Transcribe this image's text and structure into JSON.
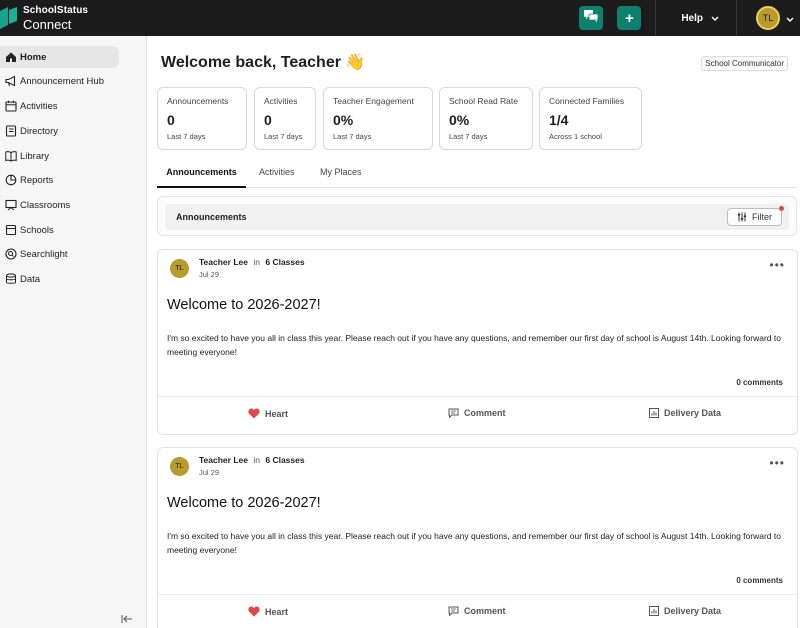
{
  "topbar": {
    "brand_line1": "SchoolStatus",
    "brand_line2": "Connect",
    "help_label": "Help",
    "user_initials": "TL",
    "accent": "#0f7f6e"
  },
  "sidebar": {
    "items": [
      {
        "label": "Home",
        "icon": "home-icon"
      },
      {
        "label": "Announcement Hub",
        "icon": "megaphone-icon"
      },
      {
        "label": "Activities",
        "icon": "activities-icon"
      },
      {
        "label": "Directory",
        "icon": "directory-icon"
      },
      {
        "label": "Library",
        "icon": "library-icon"
      },
      {
        "label": "Reports",
        "icon": "reports-pie-icon"
      },
      {
        "label": "Classrooms",
        "icon": "classrooms-icon"
      },
      {
        "label": "Schools",
        "icon": "schools-icon"
      },
      {
        "label": "Searchlight",
        "icon": "searchlight-icon"
      },
      {
        "label": "Data",
        "icon": "database-icon"
      }
    ]
  },
  "main": {
    "welcome": "Welcome back, Teacher 👋",
    "role": "School Communicator",
    "stats": [
      {
        "label": "Announcements",
        "value": "0",
        "sub": "Last 7 days"
      },
      {
        "label": "Activities",
        "value": "0",
        "sub": "Last 7 days"
      },
      {
        "label": "Teacher Engagement",
        "value": "0%",
        "sub": "Last 7 days"
      },
      {
        "label": "School Read Rate",
        "value": "0%",
        "sub": "Last 7 days"
      },
      {
        "label": "Connected Families",
        "value": "1/4",
        "sub": "Across 1 school"
      }
    ],
    "tabs": [
      "Announcements",
      "Activities",
      "My Places"
    ],
    "filter_panel_title": "Announcements",
    "filter_label": "Filter",
    "posts": [
      {
        "initials": "TL",
        "author": "Teacher Lee",
        "in": "in",
        "classes": "6 Classes",
        "date": "Jul 29",
        "title": "Welcome to 2026-2027!",
        "body": "I'm so excited to have you all in class this year. Please reach out if you have any questions, and remember our first day of school is August 14th. Looking forward to meeting everyone!",
        "comments": "0 comments",
        "heart_label": "Heart",
        "comment_label": "Comment",
        "delivery_label": "Delivery Data"
      },
      {
        "initials": "TL",
        "author": "Teacher Lee",
        "in": "in",
        "classes": "6 Classes",
        "date": "Jul 29",
        "title": "Welcome to 2026-2027!",
        "body": "I'm so excited to have you all in class this year. Please reach out if you have any questions, and remember our first day of school is August 14th. Looking forward to meeting everyone!",
        "comments": "0 comments",
        "heart_label": "Heart",
        "comment_label": "Comment",
        "delivery_label": "Delivery Data"
      }
    ]
  }
}
